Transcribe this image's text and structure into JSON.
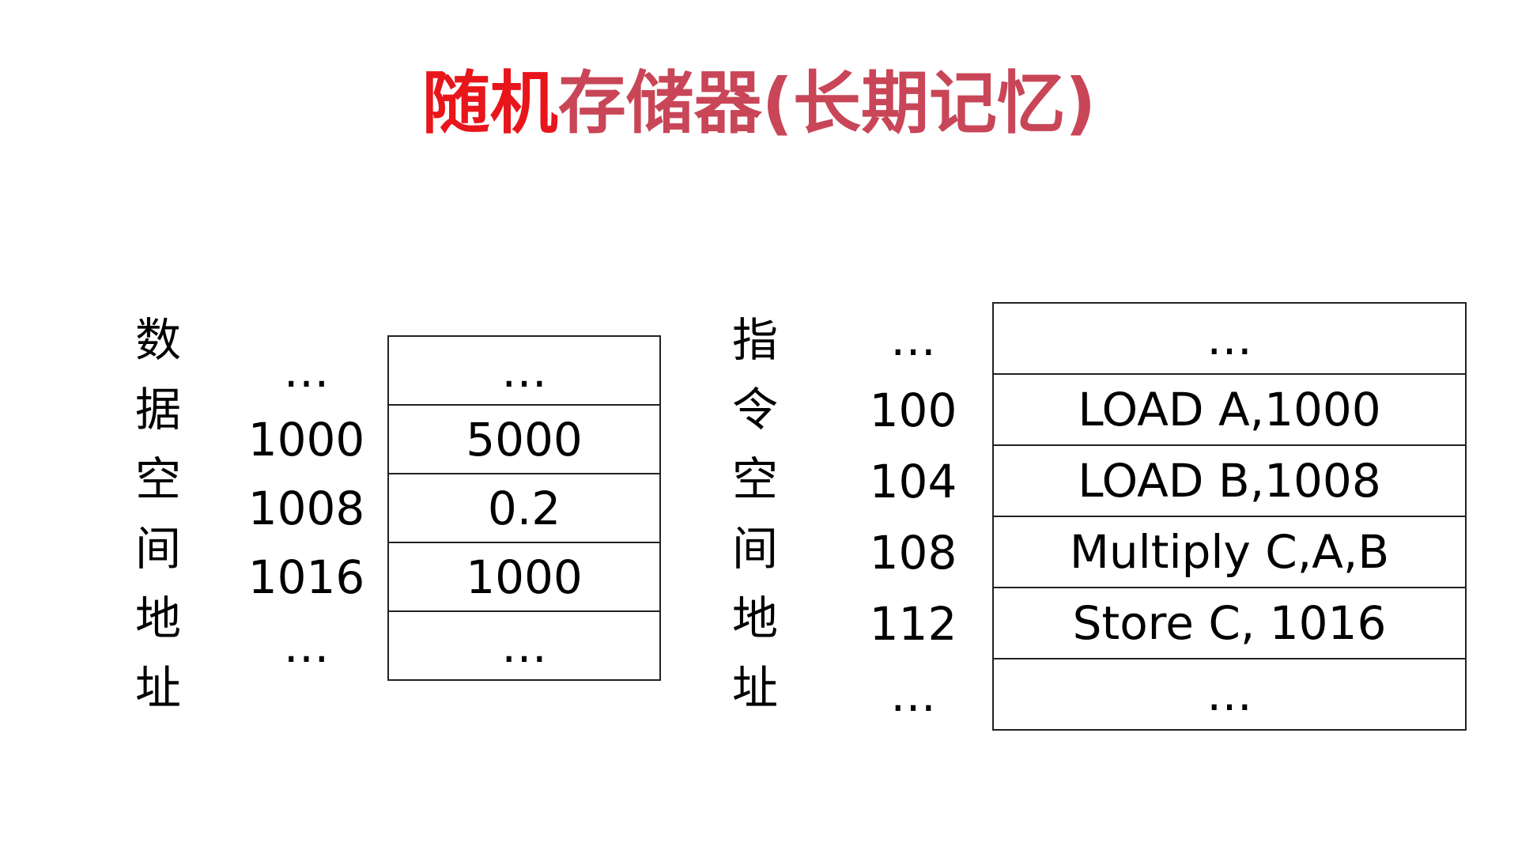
{
  "title": {
    "highlight": "随机",
    "rest": "存储器(长期记忆)",
    "highlight_color": "#e8151b",
    "rest_color": "#c84657"
  },
  "data_space": {
    "label_chars": [
      "数",
      "据",
      "空",
      "间",
      "地",
      "址"
    ],
    "addresses": [
      "…",
      "1000",
      "1008",
      "1016",
      "…"
    ],
    "cells": [
      "…",
      "5000",
      "0.2",
      "1000",
      "…"
    ]
  },
  "instruction_space": {
    "label_chars": [
      "指",
      "令",
      "空",
      "间",
      "地",
      "址"
    ],
    "addresses": [
      "…",
      "100",
      "104",
      "108",
      "112",
      "…"
    ],
    "cells": [
      "…",
      "LOAD A,1000",
      "LOAD B,1008",
      "Multiply C,A,B",
      "Store C, 1016",
      "…"
    ]
  }
}
